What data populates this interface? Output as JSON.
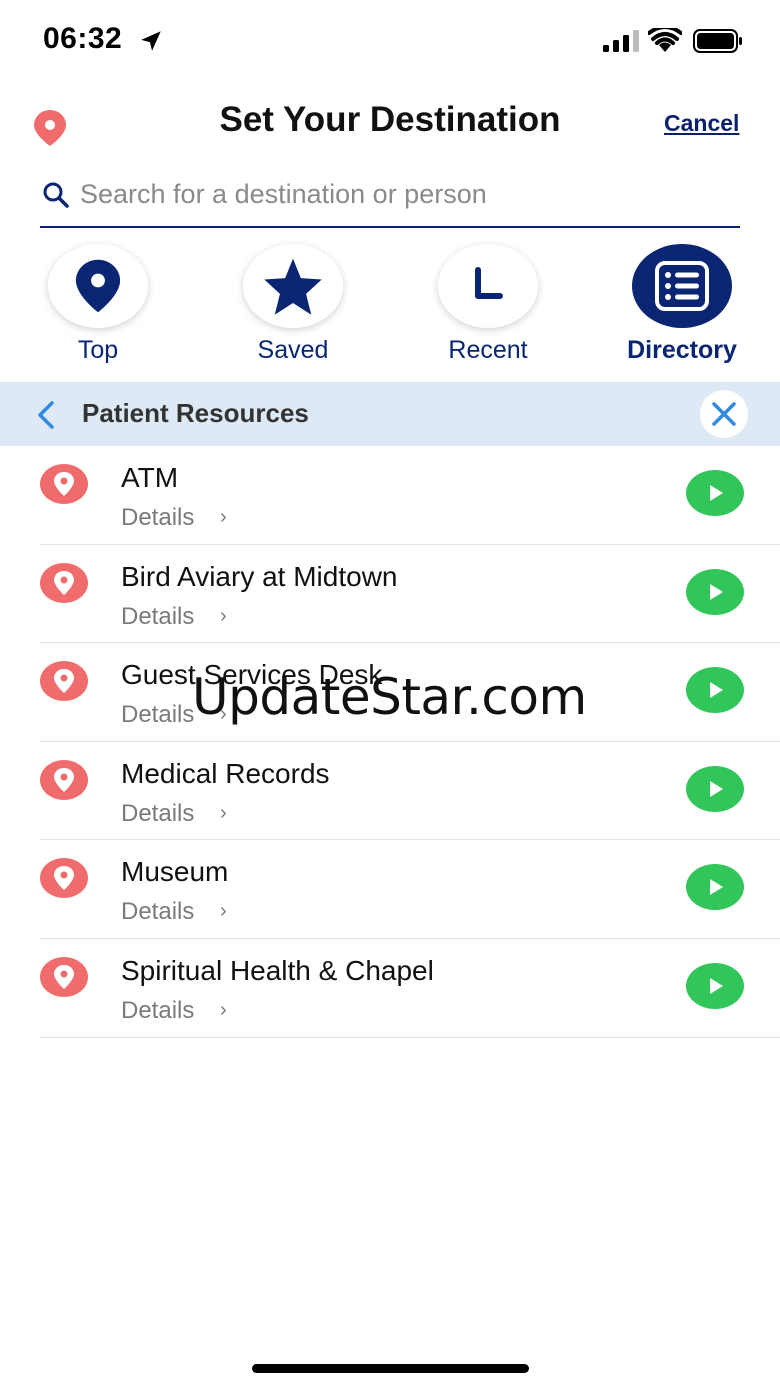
{
  "status_bar": {
    "time": "06:32",
    "icons": [
      "location-arrow-icon",
      "cellular-signal-icon",
      "wifi-icon",
      "battery-icon"
    ]
  },
  "header": {
    "title": "Set Your Destination",
    "cancel_label": "Cancel",
    "icon": "map-pin-icon"
  },
  "search": {
    "placeholder": "Search for a destination or person",
    "value": ""
  },
  "tabs": [
    {
      "label": "Top",
      "icon": "map-pin-icon",
      "active": false
    },
    {
      "label": "Saved",
      "icon": "star-icon",
      "active": false
    },
    {
      "label": "Recent",
      "icon": "clock-icon",
      "active": false
    },
    {
      "label": "Directory",
      "icon": "list-icon",
      "active": true
    }
  ],
  "breadcrumb": {
    "title": "Patient Resources",
    "back_icon": "chevron-left-icon",
    "close_icon": "close-icon"
  },
  "list": [
    {
      "name": "ATM",
      "details": "Details"
    },
    {
      "name": "Bird Aviary at Midtown",
      "details": "Details"
    },
    {
      "name": "Guest Services Desk",
      "details": "Details"
    },
    {
      "name": "Medical Records",
      "details": "Details"
    },
    {
      "name": "Museum",
      "details": "Details"
    },
    {
      "name": "Spiritual Health & Chapel",
      "details": "Details"
    }
  ],
  "details_chevron": "›",
  "watermark": "UpdateStar.com",
  "colors": {
    "navy": "#0a2672",
    "pin_red": "#f06b6b",
    "go_green": "#32c65a",
    "crumb_bg": "#dde9f4",
    "close_blue": "#2f8ae0"
  }
}
